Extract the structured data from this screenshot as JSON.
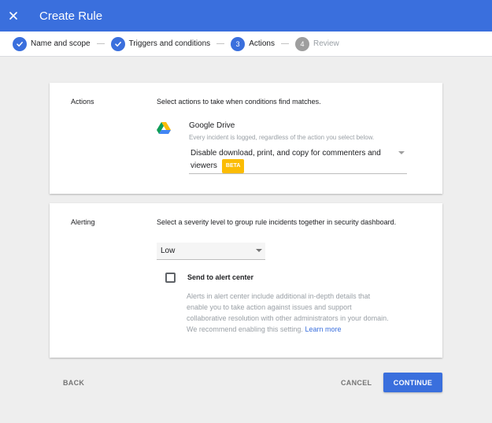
{
  "header": {
    "title": "Create Rule",
    "close_icon": "close-icon"
  },
  "stepper": {
    "steps": [
      {
        "label": "Name and scope",
        "state": "done",
        "number": "1"
      },
      {
        "label": "Triggers and conditions",
        "state": "done",
        "number": "2"
      },
      {
        "label": "Actions",
        "state": "current",
        "number": "3"
      },
      {
        "label": "Review",
        "state": "future",
        "number": "4"
      }
    ]
  },
  "actions": {
    "label": "Actions",
    "description": "Select actions to take when conditions find matches.",
    "app_name": "Google Drive",
    "app_note": "Every incident is logged, regardless of the action you select below.",
    "selected_action": "Disable download, print, and copy for commenters and viewers",
    "badge": "BETA"
  },
  "alerting": {
    "label": "Alerting",
    "description": "Select a severity level to group rule incidents together in security dashboard.",
    "severity": "Low",
    "checkbox_label": "Send to alert center",
    "checkbox_checked": false,
    "info": "Alerts in alert center include additional in-depth details that enable you to take action against issues and support collaborative resolution with other administrators in your domain. We recommend enabling this setting.",
    "learn_more": "Learn more"
  },
  "footer": {
    "back": "BACK",
    "cancel": "CANCEL",
    "continue": "CONTINUE"
  },
  "colors": {
    "primary": "#3a6fdd",
    "beta": "#fbbc04",
    "background": "#eeeeee"
  }
}
